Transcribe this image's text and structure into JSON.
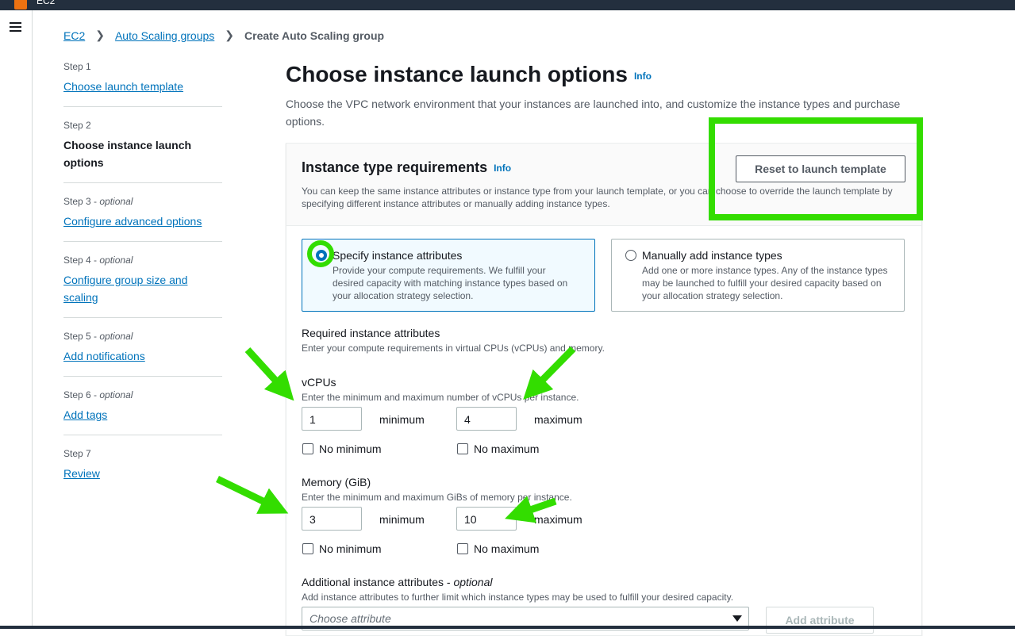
{
  "topbar": {
    "service_name": "EC2"
  },
  "breadcrumb": {
    "items": [
      "EC2",
      "Auto Scaling groups"
    ],
    "current": "Create Auto Scaling group"
  },
  "steps": [
    {
      "num": "Step 1",
      "optional": "",
      "label": "Choose launch template"
    },
    {
      "num": "Step 2",
      "optional": "",
      "label": "Choose instance launch options"
    },
    {
      "num": "Step 3",
      "optional": "optional",
      "label": "Configure advanced options"
    },
    {
      "num": "Step 4",
      "optional": "optional",
      "label": "Configure group size and scaling"
    },
    {
      "num": "Step 5",
      "optional": "optional",
      "label": "Add notifications"
    },
    {
      "num": "Step 6",
      "optional": "optional",
      "label": "Add tags"
    },
    {
      "num": "Step 7",
      "optional": "",
      "label": "Review"
    }
  ],
  "main": {
    "title": "Choose instance launch options",
    "info": "Info",
    "description": "Choose the VPC network environment that your instances are launched into, and customize the instance types and purchase options."
  },
  "panel": {
    "title": "Instance type requirements",
    "info": "Info",
    "description": "You can keep the same instance attributes or instance type from your launch template, or you can choose to override the launch template by specifying different instance attributes or manually adding instance types.",
    "reset_label": "Reset to launch template"
  },
  "tiles": [
    {
      "title": "Specify instance attributes",
      "desc": "Provide your compute requirements. We fulfill your desired capacity with matching instance types based on your allocation strategy selection.",
      "selected": true
    },
    {
      "title": "Manually add instance types",
      "desc": "Add one or more instance types. Any of the instance types may be launched to fulfill your desired capacity based on your allocation strategy selection.",
      "selected": false
    }
  ],
  "required": {
    "label": "Required instance attributes",
    "desc": "Enter your compute requirements in virtual CPUs (vCPUs) and memory."
  },
  "vcpus": {
    "label": "vCPUs",
    "desc": "Enter the minimum and maximum number of vCPUs per instance.",
    "min_value": "1",
    "max_value": "4",
    "min_suffix": "minimum",
    "max_suffix": "maximum",
    "no_min": "No minimum",
    "no_max": "No maximum"
  },
  "memory": {
    "label": "Memory (GiB)",
    "desc": "Enter the minimum and maximum GiBs of memory per instance.",
    "min_value": "3",
    "max_value": "10",
    "min_suffix": "minimum",
    "max_suffix": "maximum",
    "no_min": "No minimum",
    "no_max": "No maximum"
  },
  "additional": {
    "label": "Additional instance attributes",
    "optional": "optional",
    "desc": "Add instance attributes to further limit which instance types may be used to fulfill your desired capacity.",
    "placeholder": "Choose attribute",
    "add_label": "Add attribute"
  },
  "annotation_color": "#33dd00",
  "link_color": "#0073bb"
}
